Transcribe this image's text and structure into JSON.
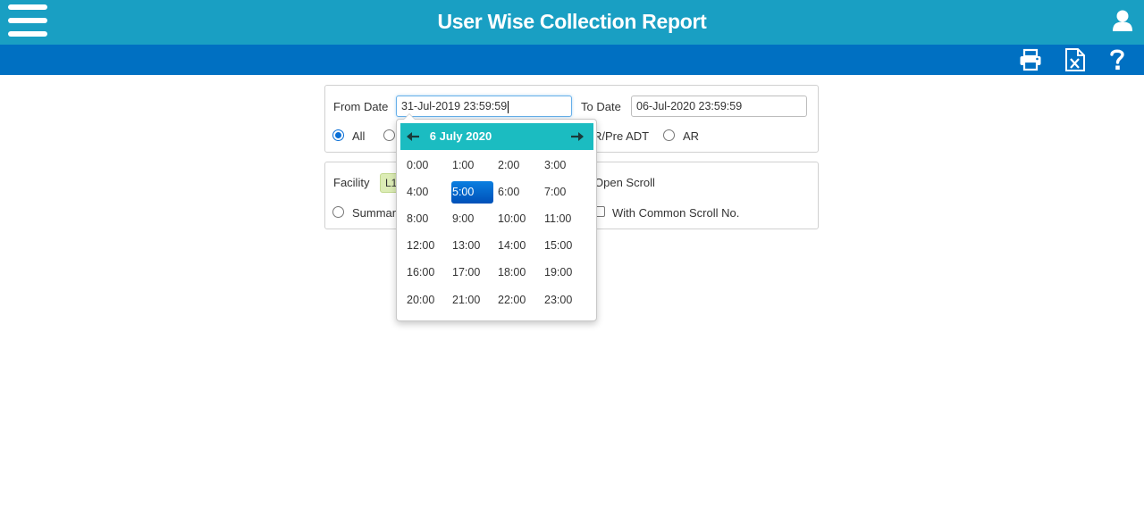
{
  "header": {
    "title": "User Wise Collection Report"
  },
  "icons": {
    "menu": "hamburger-menu-icon",
    "user": "user-icon",
    "print": "print-icon",
    "excel": "excel-export-icon",
    "help": "help-icon"
  },
  "colors": {
    "header_bg": "#199fc3",
    "toolbar_bg": "#0070c2",
    "picker_header_bg": "#1bbcc1",
    "selected_hour": "#0a6fd6"
  },
  "filters": {
    "from_date_label": "From Date",
    "from_date_value": "31-Jul-2019 23:59:59",
    "to_date_label": "To Date",
    "to_date_value": "06-Jul-2020 23:59:59",
    "radios": [
      {
        "label": "All",
        "checked": true
      },
      {
        "label": "",
        "checked": false
      },
      {
        "label": "R/Pre ADT",
        "checked": false
      },
      {
        "label": "AR",
        "checked": false
      }
    ]
  },
  "options": {
    "facility_label": "Facility",
    "facility_chip": "L1",
    "open_scroll_label": "Open Scroll",
    "summary_label": "Summary",
    "common_scroll_label": "With Common Scroll No."
  },
  "picker": {
    "title": "6 July 2020",
    "prev_icon": "arrow-left-icon",
    "next_icon": "arrow-right-icon",
    "selected": "5:00",
    "hours": [
      [
        "0:00",
        "1:00",
        "2:00",
        "3:00"
      ],
      [
        "4:00",
        "5:00",
        "6:00",
        "7:00"
      ],
      [
        "8:00",
        "9:00",
        "10:00",
        "11:00"
      ],
      [
        "12:00",
        "13:00",
        "14:00",
        "15:00"
      ],
      [
        "16:00",
        "17:00",
        "18:00",
        "19:00"
      ],
      [
        "20:00",
        "21:00",
        "22:00",
        "23:00"
      ]
    ]
  }
}
